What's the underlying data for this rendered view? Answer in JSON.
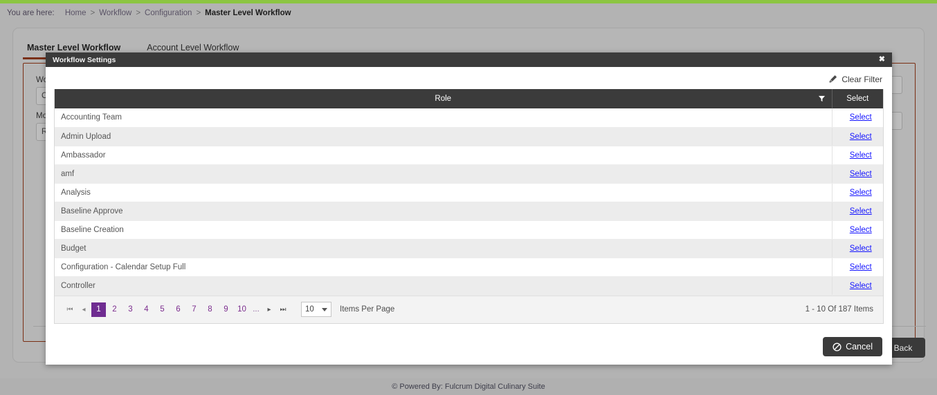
{
  "breadcrumb": {
    "prefix": "You are here:",
    "items": [
      "Home",
      "Workflow",
      "Configuration"
    ],
    "current": "Master Level Workflow",
    "separator": ">"
  },
  "background": {
    "tabs": [
      {
        "label": "Master Level Workflow",
        "active": true
      },
      {
        "label": "Account Level Workflow",
        "active": false
      }
    ],
    "fields": [
      {
        "label": "Work",
        "value": "Crea"
      },
      {
        "label": "Modu",
        "value": "Rec"
      }
    ],
    "back_label": "Back"
  },
  "modal": {
    "title": "Workflow Settings",
    "close_icon": "close-icon",
    "clear_filter": {
      "label": "Clear Filter",
      "icon": "brush-icon"
    },
    "table": {
      "columns": [
        "Role",
        "Select"
      ],
      "filter_icon": "funnel-icon",
      "select_link_label": "Select",
      "rows": [
        "Accounting Team",
        "Admin Upload",
        "Ambassador",
        "amf",
        "Analysis",
        "Baseline Approve",
        "Baseline Creation",
        "Budget",
        "Configuration - Calendar Setup Full",
        "Controller"
      ]
    },
    "pager": {
      "first_icon": "first-page-icon",
      "prev_icon": "prev-page-icon",
      "next_icon": "next-page-icon",
      "last_icon": "last-page-icon",
      "pages": [
        "1",
        "2",
        "3",
        "4",
        "5",
        "6",
        "7",
        "8",
        "9",
        "10"
      ],
      "active_page": "1",
      "ellipsis": "...",
      "page_size": "10",
      "items_per_page_label": "Items Per Page",
      "count_text": "1 - 10 Of 187 Items"
    },
    "cancel_label": "Cancel"
  },
  "footer": {
    "text": "© Powered By: Fulcrum Digital Culinary Suite"
  },
  "colors": {
    "accent_green": "#8cc542",
    "dark_header": "#3b3b3b",
    "page_active": "#6f2c91",
    "link_blue": "#1414ff",
    "panel_border_red": "#7a2e13"
  }
}
